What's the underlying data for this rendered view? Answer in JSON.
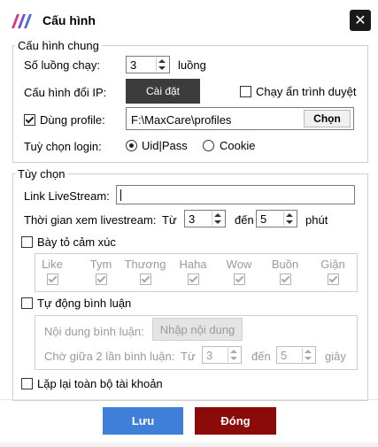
{
  "window": {
    "title": "Cấu hình"
  },
  "general": {
    "legend": "Cấu hình chung",
    "threads_label": "Số luồng chạy:",
    "threads_value": "3",
    "threads_unit": "luồng",
    "ip_label": "Cấu hình đổi IP:",
    "ip_button": "Cài đặt",
    "hidden_browser_label": "Chạy ẩn trình duyệt",
    "hidden_browser_checked": false,
    "use_profile_label": "Dùng profile:",
    "use_profile_checked": true,
    "profile_path": "F:\\MaxCare\\profiles",
    "choose_button": "Chọn",
    "login_label": "Tuỳ chọn login:",
    "login_options": [
      "Uid|Pass",
      "Cookie"
    ],
    "login_selected": "Uid|Pass"
  },
  "options": {
    "legend": "Tùy chọn",
    "livestream_label": "Link LiveStream:",
    "livestream_value": "",
    "watch_label": "Thời gian xem livestream:",
    "from_label": "Từ",
    "from_value": "3",
    "to_label": "đến",
    "to_value": "5",
    "minutes_unit": "phút",
    "reactions_label": "Bày tỏ cảm xúc",
    "reactions_checked": false,
    "reactions": [
      {
        "label": "Like",
        "checked": true
      },
      {
        "label": "Tym",
        "checked": true
      },
      {
        "label": "Thương",
        "checked": true
      },
      {
        "label": "Haha",
        "checked": true
      },
      {
        "label": "Wow",
        "checked": true
      },
      {
        "label": "Buồn",
        "checked": true
      },
      {
        "label": "Giận",
        "checked": true
      }
    ],
    "auto_comment_label": "Tự động bình luận",
    "auto_comment_checked": false,
    "comment_content_label": "Nội dung bình luận:",
    "comment_content_button": "Nhập nội dung",
    "comment_wait_label": "Chờ giữa 2 lần bình luận:",
    "comment_from_label": "Từ",
    "comment_from_value": "3",
    "comment_to_label": "đến",
    "comment_to_value": "5",
    "seconds_unit": "giây",
    "repeat_label": "Lặp lại toàn bộ tài khoản",
    "repeat_checked": false
  },
  "footer": {
    "save_label": "Lưu",
    "close_label": "Đóng",
    "save_color": "#3d7fd9",
    "close_color": "#8b0a0a"
  }
}
